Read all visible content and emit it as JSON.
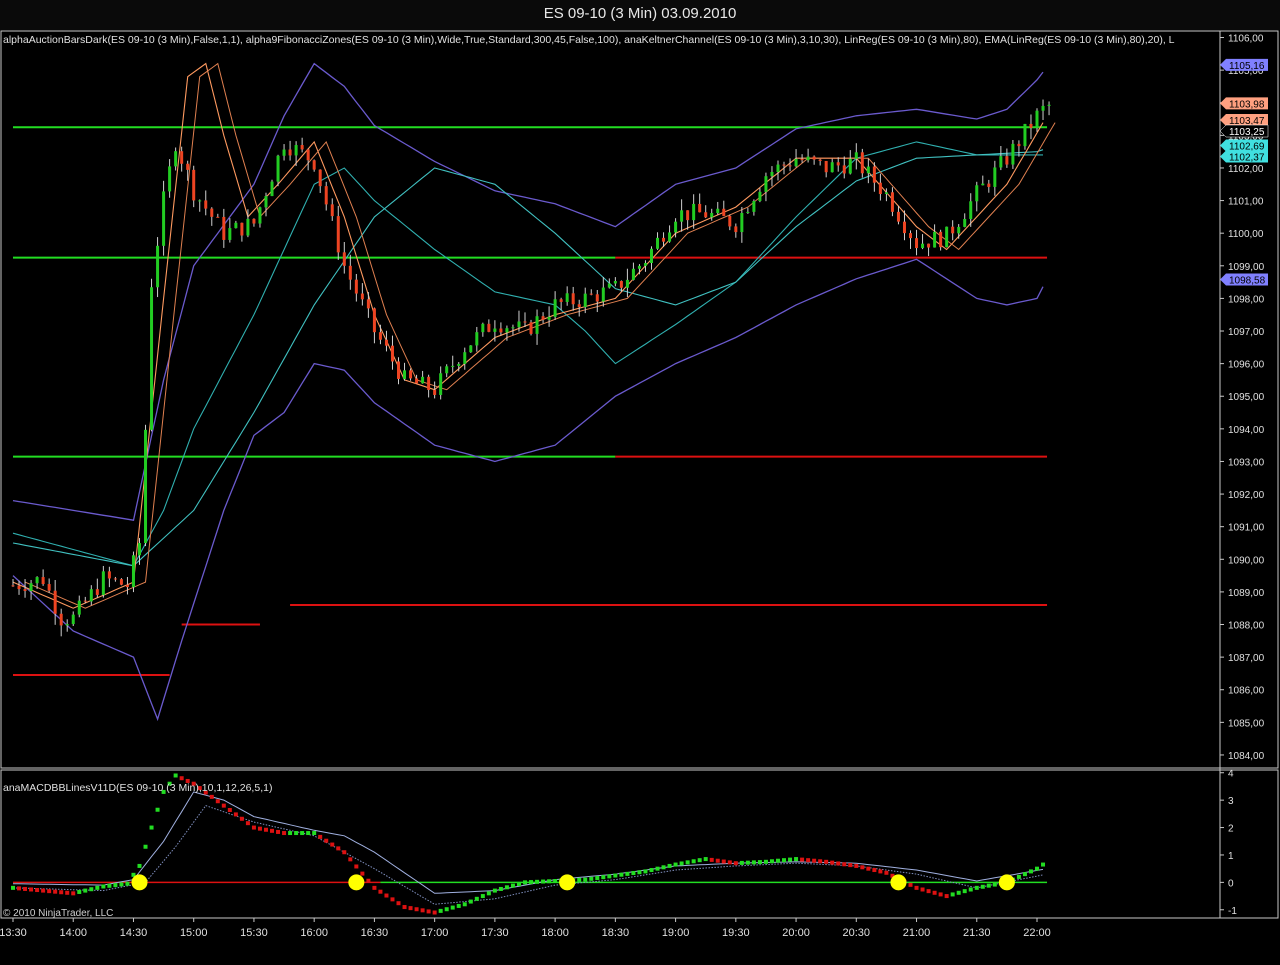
{
  "window": {
    "title": "ES 09-10 (3 Min)  03.09.2010"
  },
  "colors": {
    "background": "#000000",
    "grid_border": "#c8c8c8",
    "up_candle": "#22cc22",
    "down_candle": "#ee4422",
    "fib_green": "#22dd22",
    "fib_red": "#dd1111",
    "keltner": "#6a5acd",
    "linreg": "#ff9a60",
    "ema": "#40c0c0",
    "macd_line": "#a0b0e0",
    "signal_up": "#22dd22",
    "signal_down": "#dd1111",
    "cross_marker": "#ffff00"
  },
  "chart_data": [
    {
      "type": "line",
      "title": "ES 09-10 (3 Min)  03.09.2010",
      "indicator_label": "alphaAuctionBarsDark(ES 09-10 (3 Min),False,1,1), alpha9FibonacciZones(ES 09-10 (3 Min),Wide,True,Standard,300,45,False,100), anaKeltnerChannel(ES 09-10 (3 Min),3,10,30), LinReg(ES 09-10 (3 Min),80), EMA(LinReg(ES 09-10 (3 Min),80),20), L",
      "ylim": [
        1083.6,
        1106.2
      ],
      "y_ticks": [
        "1106,00",
        "1105,00",
        "1104,00",
        "1103,00",
        "1102,00",
        "1101,00",
        "1100,00",
        "1099,00",
        "1098,00",
        "1097,00",
        "1096,00",
        "1095,00",
        "1094,00",
        "1093,00",
        "1092,00",
        "1091,00",
        "1090,00",
        "1089,00",
        "1088,00",
        "1087,00",
        "1086,00",
        "1085,00",
        "1084,00"
      ],
      "price_labels": [
        {
          "text": "1105,16",
          "value": 1105.16,
          "color": "#8080ff"
        },
        {
          "text": "1103,98",
          "value": 1103.98,
          "color": "#ffa080"
        },
        {
          "text": "1103,47",
          "value": 1103.47,
          "color": "#ffa080"
        },
        {
          "text": "1103,25",
          "value": 1103.25,
          "color": "#000000"
        },
        {
          "text": "1102,69",
          "value": 1102.69,
          "color": "#40e0e0"
        },
        {
          "text": "1102,37",
          "value": 1102.37,
          "color": "#40e0e0"
        },
        {
          "text": "1098,58",
          "value": 1098.58,
          "color": "#8080ff"
        }
      ],
      "fib_levels": [
        {
          "value": 1103.25,
          "x_start": "13:30",
          "x_end": "22:05",
          "color": "green"
        },
        {
          "value": 1099.25,
          "x_start": "13:30",
          "x_end": "22:05",
          "color": "mixed"
        },
        {
          "value": 1093.15,
          "x_start": "13:30",
          "x_end": "22:05",
          "color": "mixed"
        },
        {
          "value": 1088.6,
          "x_start": "15:48",
          "x_end": "22:05",
          "color": "red"
        },
        {
          "value": 1088.0,
          "x_start": "14:54",
          "x_end": "15:33",
          "color": "red"
        },
        {
          "value": 1086.45,
          "x_start": "13:30",
          "x_end": "14:48",
          "color": "red"
        }
      ],
      "close_path": [
        {
          "t": "13:30",
          "v": 1089.2
        },
        {
          "t": "13:45",
          "v": 1089.4
        },
        {
          "t": "13:54",
          "v": 1088.2
        },
        {
          "t": "14:00",
          "v": 1088.2
        },
        {
          "t": "14:15",
          "v": 1089.4
        },
        {
          "t": "14:27",
          "v": 1089.2
        },
        {
          "t": "14:33",
          "v": 1090.5
        },
        {
          "t": "14:36",
          "v": 1094.0
        },
        {
          "t": "14:39",
          "v": 1098.5
        },
        {
          "t": "14:45",
          "v": 1101.0
        },
        {
          "t": "14:51",
          "v": 1102.8
        },
        {
          "t": "15:00",
          "v": 1101.3
        },
        {
          "t": "15:15",
          "v": 1100.0
        },
        {
          "t": "15:30",
          "v": 1100.3
        },
        {
          "t": "15:45",
          "v": 1102.8
        },
        {
          "t": "16:00",
          "v": 1102.2
        },
        {
          "t": "16:15",
          "v": 1099.0
        },
        {
          "t": "16:30",
          "v": 1097.0
        },
        {
          "t": "16:45",
          "v": 1095.5
        },
        {
          "t": "17:00",
          "v": 1095.2
        },
        {
          "t": "17:15",
          "v": 1096.5
        },
        {
          "t": "17:30",
          "v": 1097.3
        },
        {
          "t": "17:45",
          "v": 1097.0
        },
        {
          "t": "18:00",
          "v": 1097.8
        },
        {
          "t": "18:15",
          "v": 1098.0
        },
        {
          "t": "18:30",
          "v": 1098.3
        },
        {
          "t": "18:45",
          "v": 1099.2
        },
        {
          "t": "19:00",
          "v": 1100.6
        },
        {
          "t": "19:15",
          "v": 1100.6
        },
        {
          "t": "19:30",
          "v": 1100.3
        },
        {
          "t": "19:45",
          "v": 1101.8
        },
        {
          "t": "20:00",
          "v": 1102.3
        },
        {
          "t": "20:15",
          "v": 1102.0
        },
        {
          "t": "20:30",
          "v": 1102.2
        },
        {
          "t": "20:45",
          "v": 1101.2
        },
        {
          "t": "21:00",
          "v": 1099.7
        },
        {
          "t": "21:15",
          "v": 1099.9
        },
        {
          "t": "21:30",
          "v": 1101.2
        },
        {
          "t": "21:45",
          "v": 1102.3
        },
        {
          "t": "22:00",
          "v": 1103.6
        },
        {
          "t": "22:05",
          "v": 1103.9
        }
      ],
      "keltner_upper": [
        {
          "t": "13:30",
          "v": 1091.8
        },
        {
          "t": "14:30",
          "v": 1091.2
        },
        {
          "t": "14:45",
          "v": 1095.5
        },
        {
          "t": "15:00",
          "v": 1099.0
        },
        {
          "t": "15:30",
          "v": 1101.5
        },
        {
          "t": "15:45",
          "v": 1103.6
        },
        {
          "t": "16:00",
          "v": 1105.2
        },
        {
          "t": "16:15",
          "v": 1104.5
        },
        {
          "t": "16:30",
          "v": 1103.3
        },
        {
          "t": "17:00",
          "v": 1102.2
        },
        {
          "t": "17:30",
          "v": 1101.3
        },
        {
          "t": "18:00",
          "v": 1100.9
        },
        {
          "t": "18:30",
          "v": 1100.2
        },
        {
          "t": "19:00",
          "v": 1101.5
        },
        {
          "t": "19:30",
          "v": 1102.0
        },
        {
          "t": "20:00",
          "v": 1103.2
        },
        {
          "t": "20:30",
          "v": 1103.6
        },
        {
          "t": "21:00",
          "v": 1103.8
        },
        {
          "t": "21:30",
          "v": 1103.5
        },
        {
          "t": "21:45",
          "v": 1103.8
        },
        {
          "t": "22:00",
          "v": 1104.7
        },
        {
          "t": "22:05",
          "v": 1105.1
        }
      ],
      "keltner_lower": [
        {
          "t": "13:30",
          "v": 1089.5
        },
        {
          "t": "14:00",
          "v": 1087.8
        },
        {
          "t": "14:30",
          "v": 1087.0
        },
        {
          "t": "14:42",
          "v": 1085.1
        },
        {
          "t": "14:54",
          "v": 1087.5
        },
        {
          "t": "15:15",
          "v": 1091.5
        },
        {
          "t": "15:30",
          "v": 1093.8
        },
        {
          "t": "15:45",
          "v": 1094.5
        },
        {
          "t": "16:00",
          "v": 1096.0
        },
        {
          "t": "16:15",
          "v": 1095.8
        },
        {
          "t": "16:30",
          "v": 1094.8
        },
        {
          "t": "17:00",
          "v": 1093.5
        },
        {
          "t": "17:30",
          "v": 1093.0
        },
        {
          "t": "18:00",
          "v": 1093.5
        },
        {
          "t": "18:30",
          "v": 1095.0
        },
        {
          "t": "19:00",
          "v": 1096.0
        },
        {
          "t": "19:30",
          "v": 1096.8
        },
        {
          "t": "20:00",
          "v": 1097.8
        },
        {
          "t": "20:30",
          "v": 1098.6
        },
        {
          "t": "21:00",
          "v": 1099.2
        },
        {
          "t": "21:15",
          "v": 1098.6
        },
        {
          "t": "21:30",
          "v": 1098.0
        },
        {
          "t": "21:45",
          "v": 1097.8
        },
        {
          "t": "22:00",
          "v": 1098.0
        },
        {
          "t": "22:05",
          "v": 1098.6
        }
      ],
      "keltner_mid": [
        {
          "t": "13:30",
          "v": 1090.8
        },
        {
          "t": "14:30",
          "v": 1089.8
        },
        {
          "t": "14:45",
          "v": 1091.5
        },
        {
          "t": "15:00",
          "v": 1094.0
        },
        {
          "t": "15:30",
          "v": 1097.5
        },
        {
          "t": "15:45",
          "v": 1099.5
        },
        {
          "t": "16:00",
          "v": 1101.5
        },
        {
          "t": "16:15",
          "v": 1102.0
        },
        {
          "t": "16:30",
          "v": 1101.0
        },
        {
          "t": "17:00",
          "v": 1099.5
        },
        {
          "t": "17:30",
          "v": 1098.2
        },
        {
          "t": "18:00",
          "v": 1097.8
        },
        {
          "t": "18:15",
          "v": 1097.0
        },
        {
          "t": "18:30",
          "v": 1096.0
        },
        {
          "t": "19:00",
          "v": 1097.2
        },
        {
          "t": "19:30",
          "v": 1098.5
        },
        {
          "t": "20:00",
          "v": 1100.5
        },
        {
          "t": "20:30",
          "v": 1102.3
        },
        {
          "t": "21:00",
          "v": 1102.8
        },
        {
          "t": "21:30",
          "v": 1102.4
        },
        {
          "t": "22:00",
          "v": 1102.4
        },
        {
          "t": "22:05",
          "v": 1102.4
        }
      ],
      "ema": [
        {
          "t": "13:30",
          "v": 1090.5
        },
        {
          "t": "14:30",
          "v": 1089.8
        },
        {
          "t": "15:00",
          "v": 1091.5
        },
        {
          "t": "15:30",
          "v": 1094.5
        },
        {
          "t": "16:00",
          "v": 1097.8
        },
        {
          "t": "16:30",
          "v": 1100.5
        },
        {
          "t": "17:00",
          "v": 1102.0
        },
        {
          "t": "17:30",
          "v": 1101.5
        },
        {
          "t": "18:00",
          "v": 1100.0
        },
        {
          "t": "18:30",
          "v": 1098.3
        },
        {
          "t": "19:00",
          "v": 1097.8
        },
        {
          "t": "19:30",
          "v": 1098.5
        },
        {
          "t": "20:00",
          "v": 1100.2
        },
        {
          "t": "20:30",
          "v": 1101.6
        },
        {
          "t": "21:00",
          "v": 1102.3
        },
        {
          "t": "21:30",
          "v": 1102.4
        },
        {
          "t": "22:00",
          "v": 1102.5
        },
        {
          "t": "22:05",
          "v": 1102.6
        }
      ],
      "linreg": [
        {
          "t": "13:30",
          "v": 1089.3
        },
        {
          "t": "14:00",
          "v": 1088.5
        },
        {
          "t": "14:30",
          "v": 1089.3
        },
        {
          "t": "14:45",
          "v": 1098.0
        },
        {
          "t": "14:57",
          "v": 1104.8
        },
        {
          "t": "15:06",
          "v": 1105.2
        },
        {
          "t": "15:15",
          "v": 1103.0
        },
        {
          "t": "15:27",
          "v": 1100.5
        },
        {
          "t": "15:42",
          "v": 1101.5
        },
        {
          "t": "16:00",
          "v": 1102.8
        },
        {
          "t": "16:15",
          "v": 1100.5
        },
        {
          "t": "16:30",
          "v": 1097.5
        },
        {
          "t": "16:45",
          "v": 1095.5
        },
        {
          "t": "17:00",
          "v": 1095.2
        },
        {
          "t": "17:30",
          "v": 1096.8
        },
        {
          "t": "18:00",
          "v": 1097.5
        },
        {
          "t": "18:30",
          "v": 1098.0
        },
        {
          "t": "19:00",
          "v": 1100.0
        },
        {
          "t": "19:30",
          "v": 1100.8
        },
        {
          "t": "20:00",
          "v": 1102.3
        },
        {
          "t": "20:30",
          "v": 1102.3
        },
        {
          "t": "21:00",
          "v": 1100.2
        },
        {
          "t": "21:15",
          "v": 1099.5
        },
        {
          "t": "21:45",
          "v": 1101.5
        },
        {
          "t": "22:05",
          "v": 1103.6
        }
      ],
      "x_ticks": [
        "13:30",
        "14:00",
        "14:30",
        "15:00",
        "15:30",
        "16:00",
        "16:30",
        "17:00",
        "17:30",
        "18:00",
        "18:30",
        "19:00",
        "19:30",
        "20:00",
        "20:30",
        "21:00",
        "21:30",
        "22:00"
      ],
      "xlim": [
        "13:27",
        "22:21"
      ]
    },
    {
      "type": "line",
      "title": "anaMACDBBLinesV11D(ES 09-10 (3 Min),10,1,12,26,5,1)",
      "ylim": [
        -1.3,
        4.1
      ],
      "y_ticks": [
        "4",
        "3",
        "2",
        "1",
        "0",
        "-1"
      ],
      "zero_line": 0,
      "macd_dots": [
        {
          "t": "13:30",
          "v": -0.2
        },
        {
          "t": "13:45",
          "v": -0.3
        },
        {
          "t": "14:00",
          "v": -0.4
        },
        {
          "t": "14:15",
          "v": -0.15
        },
        {
          "t": "14:27",
          "v": -0.05
        },
        {
          "t": "14:33",
          "v": 0.6
        },
        {
          "t": "14:39",
          "v": 2.0
        },
        {
          "t": "14:45",
          "v": 3.3
        },
        {
          "t": "14:51",
          "v": 3.9
        },
        {
          "t": "15:00",
          "v": 3.6
        },
        {
          "t": "15:15",
          "v": 2.8
        },
        {
          "t": "15:30",
          "v": 2.0
        },
        {
          "t": "15:45",
          "v": 1.8
        },
        {
          "t": "16:00",
          "v": 1.8
        },
        {
          "t": "16:15",
          "v": 1.1
        },
        {
          "t": "16:30",
          "v": -0.2
        },
        {
          "t": "16:45",
          "v": -0.9
        },
        {
          "t": "17:00",
          "v": -1.1
        },
        {
          "t": "17:15",
          "v": -0.8
        },
        {
          "t": "17:30",
          "v": -0.3
        },
        {
          "t": "17:45",
          "v": 0.0
        },
        {
          "t": "18:00",
          "v": 0.05
        },
        {
          "t": "18:15",
          "v": 0.1
        },
        {
          "t": "18:30",
          "v": 0.25
        },
        {
          "t": "18:45",
          "v": 0.4
        },
        {
          "t": "19:00",
          "v": 0.65
        },
        {
          "t": "19:15",
          "v": 0.85
        },
        {
          "t": "19:30",
          "v": 0.7
        },
        {
          "t": "19:45",
          "v": 0.75
        },
        {
          "t": "20:00",
          "v": 0.85
        },
        {
          "t": "20:15",
          "v": 0.75
        },
        {
          "t": "20:30",
          "v": 0.6
        },
        {
          "t": "20:45",
          "v": 0.35
        },
        {
          "t": "21:00",
          "v": -0.2
        },
        {
          "t": "21:15",
          "v": -0.5
        },
        {
          "t": "21:30",
          "v": -0.2
        },
        {
          "t": "21:45",
          "v": 0.0
        },
        {
          "t": "22:00",
          "v": 0.5
        },
        {
          "t": "22:05",
          "v": 0.75
        }
      ],
      "bb_upper": [
        {
          "t": "13:30",
          "v": -0.05
        },
        {
          "t": "14:15",
          "v": -0.1
        },
        {
          "t": "14:30",
          "v": 0.1
        },
        {
          "t": "14:45",
          "v": 1.5
        },
        {
          "t": "15:00",
          "v": 3.3
        },
        {
          "t": "15:15",
          "v": 3.0
        },
        {
          "t": "15:30",
          "v": 2.4
        },
        {
          "t": "16:00",
          "v": 1.9
        },
        {
          "t": "16:15",
          "v": 1.7
        },
        {
          "t": "16:30",
          "v": 1.1
        },
        {
          "t": "17:00",
          "v": -0.4
        },
        {
          "t": "17:30",
          "v": -0.3
        },
        {
          "t": "18:00",
          "v": 0.1
        },
        {
          "t": "18:30",
          "v": 0.3
        },
        {
          "t": "19:00",
          "v": 0.6
        },
        {
          "t": "19:30",
          "v": 0.7
        },
        {
          "t": "20:00",
          "v": 0.75
        },
        {
          "t": "20:30",
          "v": 0.7
        },
        {
          "t": "21:00",
          "v": 0.45
        },
        {
          "t": "21:30",
          "v": 0.05
        },
        {
          "t": "22:05",
          "v": 0.5
        }
      ],
      "bb_lower": [
        {
          "t": "13:30",
          "v": -0.2
        },
        {
          "t": "14:15",
          "v": -0.3
        },
        {
          "t": "14:36",
          "v": 0.0
        },
        {
          "t": "14:51",
          "v": 1.3
        },
        {
          "t": "15:06",
          "v": 2.8
        },
        {
          "t": "15:30",
          "v": 2.2
        },
        {
          "t": "16:00",
          "v": 1.7
        },
        {
          "t": "16:30",
          "v": 0.5
        },
        {
          "t": "17:00",
          "v": -0.8
        },
        {
          "t": "17:30",
          "v": -0.6
        },
        {
          "t": "18:00",
          "v": -0.1
        },
        {
          "t": "18:30",
          "v": 0.1
        },
        {
          "t": "19:00",
          "v": 0.45
        },
        {
          "t": "19:30",
          "v": 0.6
        },
        {
          "t": "20:00",
          "v": 0.7
        },
        {
          "t": "20:30",
          "v": 0.6
        },
        {
          "t": "21:00",
          "v": 0.3
        },
        {
          "t": "21:30",
          "v": -0.2
        },
        {
          "t": "22:05",
          "v": 0.3
        }
      ],
      "cross_markers": [
        "14:33",
        "16:21",
        "18:06",
        "20:51",
        "21:45"
      ]
    }
  ],
  "footer": {
    "copyright": "© 2010 NinjaTrader, LLC"
  }
}
